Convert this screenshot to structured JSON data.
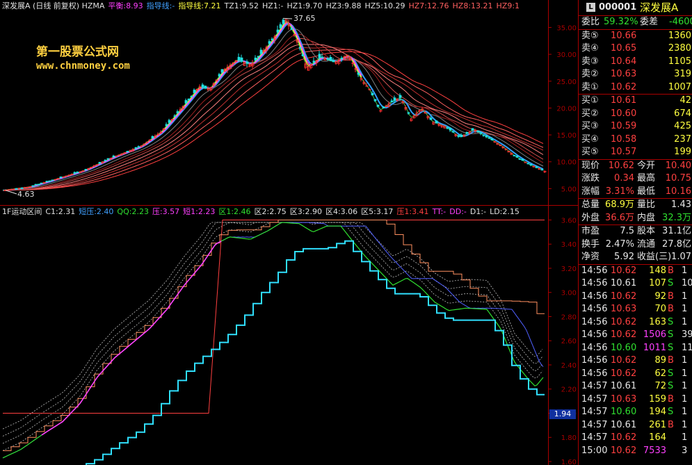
{
  "top_legend": {
    "title": "深发展A (日线 前复权) HZMA",
    "items": [
      {
        "text": "平衡:8.93",
        "color": "#ff40ff"
      },
      {
        "text": "指导线:-",
        "color": "#40a0ff"
      },
      {
        "text": "指导线:7.21",
        "color": "#ffff40"
      },
      {
        "text": "TZ1:9.52",
        "color": "#e0e0e0"
      },
      {
        "text": "HZ1:-",
        "color": "#e0e0e0"
      },
      {
        "text": "HZ1:9.70",
        "color": "#e0e0e0"
      },
      {
        "text": "HZ3:9.88",
        "color": "#e0e0e0"
      },
      {
        "text": "HZ5:10.29",
        "color": "#e0e0e0"
      },
      {
        "text": "HZ7:12.76",
        "color": "#ff6060"
      },
      {
        "text": "HZ8:13.21",
        "color": "#ff6060"
      },
      {
        "text": "HZ9:1",
        "color": "#ff6060"
      }
    ]
  },
  "bottom_legend": {
    "title": "1F运动区间",
    "items": [
      {
        "text": "C1:2.31",
        "color": "#e0e0e0"
      },
      {
        "text": "短压:2.40",
        "color": "#40a0ff"
      },
      {
        "text": "QQ:2.23",
        "color": "#30e030"
      },
      {
        "text": "压:3.57",
        "color": "#ff40ff"
      },
      {
        "text": "短1:2.23",
        "color": "#ff40ff"
      },
      {
        "text": "区1:2.46",
        "color": "#30e030"
      },
      {
        "text": "区2:2.75",
        "color": "#e0e0e0"
      },
      {
        "text": "区3:2.90",
        "color": "#e0e0e0"
      },
      {
        "text": "区4:3.06",
        "color": "#e0e0e0"
      },
      {
        "text": "区5:3.17",
        "color": "#e0e0e0"
      },
      {
        "text": "压1:3.41",
        "color": "#ff4040"
      },
      {
        "text": "TT:-",
        "color": "#ff40ff"
      },
      {
        "text": "DD:-",
        "color": "#ff40ff"
      },
      {
        "text": "D1:-",
        "color": "#e0e0e0"
      },
      {
        "text": "LD:2.15",
        "color": "#e0e0e0"
      }
    ]
  },
  "watermark": {
    "line1": "第一股票公式网",
    "line2": "www.chnmoney.com"
  },
  "annotations": {
    "high": "37.65",
    "low": "4.63",
    "low_price_tag": "1.94"
  },
  "price_axis": [
    "35.00",
    "30.00",
    "25.00",
    "20.00",
    "15.00",
    "10.00",
    "5.00"
  ],
  "indicator_axis": [
    "3.60",
    "3.40",
    "3.20",
    "3.00",
    "2.80",
    "2.60",
    "2.40",
    "2.20",
    "2.00",
    "1.80",
    "1.60"
  ],
  "panel": {
    "code": "000001",
    "name": "深发展A",
    "ratio_label": "委比",
    "ratio_value": "59.32%",
    "diff_label": "委差",
    "diff_value": "-4600",
    "sells": [
      {
        "label": "卖⑤",
        "price": "10.66",
        "vol": "1360"
      },
      {
        "label": "卖④",
        "price": "10.65",
        "vol": "2380"
      },
      {
        "label": "卖③",
        "price": "10.64",
        "vol": "1105"
      },
      {
        "label": "卖②",
        "price": "10.63",
        "vol": "319"
      },
      {
        "label": "卖①",
        "price": "10.62",
        "vol": "1007"
      }
    ],
    "buys": [
      {
        "label": "买①",
        "price": "10.61",
        "vol": "42"
      },
      {
        "label": "买②",
        "price": "10.60",
        "vol": "674"
      },
      {
        "label": "买③",
        "price": "10.59",
        "vol": "425"
      },
      {
        "label": "买④",
        "price": "10.58",
        "vol": "237"
      },
      {
        "label": "买⑤",
        "price": "10.57",
        "vol": "199"
      }
    ],
    "stats": [
      {
        "l1": "现价",
        "v1": "10.62",
        "c1": "#ff4040",
        "l2": "今开",
        "v2": "10.40",
        "c2": "#ff4040"
      },
      {
        "l1": "涨跌",
        "v1": "0.34",
        "c1": "#ff4040",
        "l2": "最高",
        "v2": "10.75",
        "c2": "#ff4040"
      },
      {
        "l1": "涨幅",
        "v1": "3.31%",
        "c1": "#ff4040",
        "l2": "最低",
        "v2": "10.16",
        "c2": "#ff4040"
      },
      {
        "l1": "总量",
        "v1": "68.9万",
        "c1": "#ffff40",
        "l2": "量比",
        "v2": "1.43",
        "c2": "#e6e6e6"
      },
      {
        "l1": "外盘",
        "v1": "36.6万",
        "c1": "#ff4040",
        "l2": "内盘",
        "v2": "32.3万",
        "c2": "#30e030"
      },
      {
        "l1": "市盈",
        "v1": "7.5",
        "c1": "#e6e6e6",
        "l2": "股本",
        "v2": "31.1亿",
        "c2": "#e6e6e6"
      },
      {
        "l1": "换手",
        "v1": "2.47%",
        "c1": "#e6e6e6",
        "l2": "流通",
        "v2": "27.8亿",
        "c2": "#e6e6e6"
      },
      {
        "l1": "净资",
        "v1": "5.92",
        "c1": "#e6e6e6",
        "l2": "收益(三)",
        "v2": "1.07",
        "c2": "#e6e6e6"
      }
    ],
    "ticks": [
      {
        "t": "14:56",
        "p": "10.62",
        "v": "148",
        "s": "B",
        "n": "1"
      },
      {
        "t": "14:56",
        "p": "10.61",
        "v": "107",
        "s": "S",
        "n": "10"
      },
      {
        "t": "14:56",
        "p": "10.62",
        "v": "92",
        "s": "B",
        "n": "1"
      },
      {
        "t": "14:56",
        "p": "10.63",
        "v": "70",
        "s": "B",
        "n": "1"
      },
      {
        "t": "14:56",
        "p": "10.62",
        "v": "163",
        "s": "S",
        "n": "1"
      },
      {
        "t": "14:56",
        "p": "10.62",
        "v": "1506",
        "s": "S",
        "n": "39"
      },
      {
        "t": "14:56",
        "p": "10.60",
        "v": "1011",
        "s": "S",
        "n": "11"
      },
      {
        "t": "14:56",
        "p": "10.62",
        "v": "89",
        "s": "B",
        "n": "1"
      },
      {
        "t": "14:56",
        "p": "10.62",
        "v": "62",
        "s": "S",
        "n": "1"
      },
      {
        "t": "14:57",
        "p": "10.61",
        "v": "72",
        "s": "S",
        "n": "1"
      },
      {
        "t": "14:57",
        "p": "10.63",
        "v": "159",
        "s": "B",
        "n": "1"
      },
      {
        "t": "14:57",
        "p": "10.60",
        "v": "194",
        "s": "S",
        "n": "1"
      },
      {
        "t": "14:57",
        "p": "10.61",
        "v": "261",
        "s": "B",
        "n": "1"
      },
      {
        "t": "14:57",
        "p": "10.62",
        "v": "164",
        "s": "",
        "n": "1"
      },
      {
        "t": "15:00",
        "p": "10.62",
        "v": "7533",
        "s": "",
        "n": "3"
      }
    ]
  }
}
